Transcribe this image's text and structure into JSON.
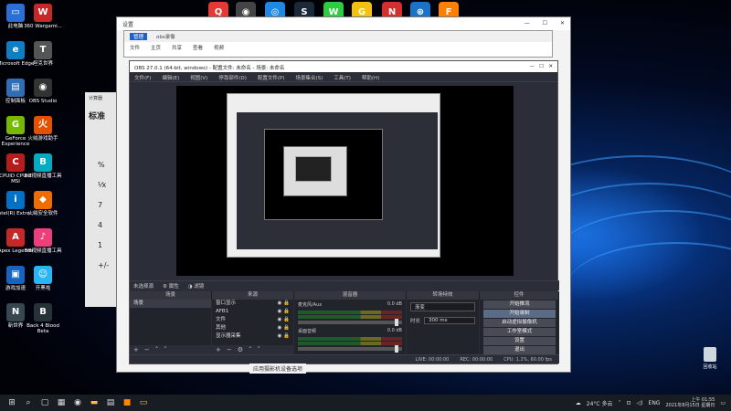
{
  "top_icons": [
    {
      "name": "qq-icon",
      "color": "#e53935",
      "glyph": "Q"
    },
    {
      "name": "obs-icon",
      "color": "#444",
      "glyph": "◉"
    },
    {
      "name": "browser-icon",
      "color": "#1e88e5",
      "glyph": "◎"
    },
    {
      "name": "steam-icon",
      "color": "#1b2838",
      "glyph": "S"
    },
    {
      "name": "wechat-icon",
      "color": "#2ecc40",
      "glyph": "W"
    },
    {
      "name": "game-icon",
      "color": "#f4c20d",
      "glyph": "G"
    },
    {
      "name": "netease-music-icon",
      "color": "#d32f2f",
      "glyph": "N"
    },
    {
      "name": "network-icon",
      "color": "#1a73c7",
      "glyph": "⊕"
    },
    {
      "name": "firefox-icon",
      "color": "#ff7f00",
      "glyph": "F"
    }
  ],
  "desktop_icons": [
    {
      "name": "this-pc",
      "label": "此电脑",
      "color": "#2b6fd6",
      "glyph": "▭"
    },
    {
      "name": "360-wargaming",
      "label": "360 Wargami...",
      "color": "#c62828",
      "glyph": "W"
    },
    {
      "name": "edge",
      "label": "Microsoft Edge",
      "color": "#0e7fc3",
      "glyph": "e"
    },
    {
      "name": "wot",
      "label": "坦克世界",
      "color": "#555",
      "glyph": "T"
    },
    {
      "name": "control-panel",
      "label": "控制面板",
      "color": "#2f6eb5",
      "glyph": "▤"
    },
    {
      "name": "obs-studio",
      "label": "OBS Studio",
      "color": "#333",
      "glyph": "◉"
    },
    {
      "name": "geforce",
      "label": "GeForce Experience",
      "color": "#76b900",
      "glyph": "G"
    },
    {
      "name": "game-tool",
      "label": "火绒游戏助手",
      "color": "#e65100",
      "glyph": "火"
    },
    {
      "name": "cpuid",
      "label": "CPUID CPU-Z MSI",
      "color": "#b71c1c",
      "glyph": "C"
    },
    {
      "name": "mango-video",
      "label": "BH视频直播工具",
      "color": "#00acc1",
      "glyph": "B"
    },
    {
      "name": "intel",
      "label": "Intel(R) Extre...",
      "color": "#0071c5",
      "glyph": "i"
    },
    {
      "name": "security",
      "label": "火绒安全软件",
      "color": "#ef6c00",
      "glyph": "◆"
    },
    {
      "name": "apex",
      "label": "Apex Legends",
      "color": "#c62828",
      "glyph": "A"
    },
    {
      "name": "live-tool",
      "label": "BH视频直播工具",
      "color": "#ec407a",
      "glyph": "♪"
    },
    {
      "name": "game-center",
      "label": "游戏加速",
      "color": "#1565c0",
      "glyph": "▣"
    },
    {
      "name": "chat",
      "label": "开黑啦",
      "color": "#29b6f6",
      "glyph": "☺"
    },
    {
      "name": "new-world",
      "label": "新世界",
      "color": "#37474f",
      "glyph": "N"
    },
    {
      "name": "back4blood",
      "label": "Back 4 Blood Beta",
      "color": "#263238",
      "glyph": "B"
    }
  ],
  "explorer": {
    "title": "设置"
  },
  "explorer2": {
    "tabs": [
      "文件",
      "主页",
      "共享",
      "查看",
      "视频"
    ],
    "active_tab": "管理",
    "path_label": "obs录像"
  },
  "calculator": {
    "title": "计算器",
    "mode": "标准",
    "keys": [
      "%",
      "⅟x",
      "7",
      "4",
      "1",
      "+/-"
    ]
  },
  "obs": {
    "title": "OBS 27.0.1 (64-bit, windows) - 配置文件: 未命名 - 场景: 未命名",
    "menu": [
      "文件(F)",
      "编辑(E)",
      "视图(V)",
      "停靠部件(D)",
      "配置文件(P)",
      "场景集合(S)",
      "工具(T)",
      "帮助(H)"
    ],
    "scene_bar": {
      "no_source": "未选择源",
      "properties": "属性",
      "filters": "滤镜"
    },
    "panel_titles": [
      "场景",
      "来源",
      "混音器",
      "转场特效",
      "控件"
    ],
    "scenes": [
      "场景"
    ],
    "sources": [
      "窗口显示",
      "AFB1",
      "文件",
      "其他",
      "显示器采集"
    ],
    "mixer": [
      {
        "name": "麦克风/Aux",
        "db": "0.0 dB"
      },
      {
        "name": "桌面音频",
        "db": "0.0 dB"
      }
    ],
    "transition": {
      "type_label": "渐变",
      "duration_label": "时长",
      "duration_value": "300 ms"
    },
    "controls": [
      "开始推流",
      "开始录制",
      "启动虚拟摄像机",
      "工作室模式",
      "设置",
      "退出"
    ],
    "status": {
      "live": "LIVE: 00:00:00",
      "rec": "REC: 00:00:00",
      "cpu": "CPU: 1.2%, 60.00 fps"
    }
  },
  "settings_link": "应用摄影机设备选项",
  "recycle_bin": "回收站",
  "taskbar": {
    "weather": "24°C 多云",
    "lang": "ENG",
    "time": "上午 01:55",
    "date": "2021年8月15日 星期日"
  }
}
